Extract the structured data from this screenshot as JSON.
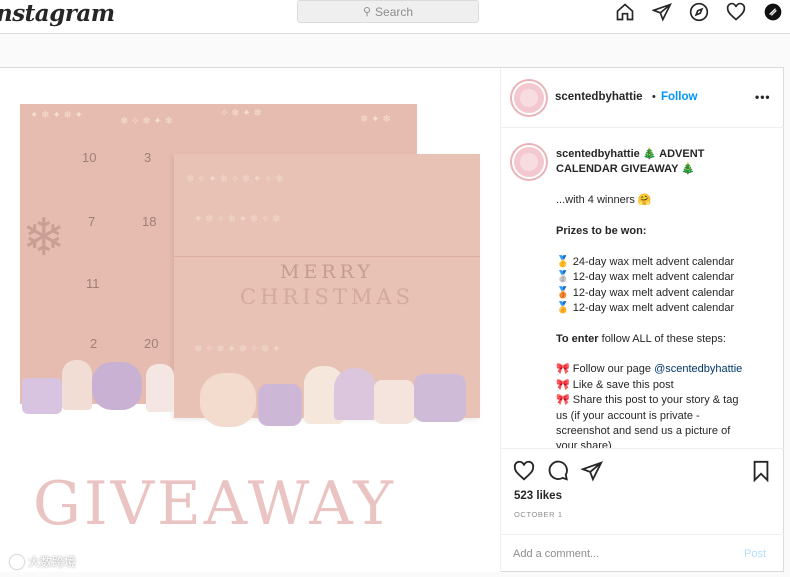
{
  "topbar": {
    "logo": "nstagram",
    "search_placeholder": "Search",
    "search_icon": "search-icon",
    "nav_icons": [
      "home-icon",
      "direct-icon",
      "explore-icon",
      "heart-icon",
      "profile-avatar"
    ]
  },
  "post": {
    "username": "scentedbyhattie",
    "separator": "•",
    "follow_label": "Follow",
    "more_label": "•••",
    "image_text": {
      "giveaway": "GIVEAWAY",
      "merry": "MERRY",
      "christmas": "CHRISTMAS",
      "back_box_numbers": [
        "10",
        "3",
        "7",
        "18",
        "11",
        "2",
        "20"
      ]
    },
    "caption": {
      "username": "scentedbyhattie",
      "title_rest": "🎄 ADVENT",
      "title_line2": "CALENDAR GIVEAWAY 🎄",
      "winners": "...with 4 winners 🤗",
      "prizes_heading": "Prizes to be won:",
      "prizes": [
        "🥇 24-day wax melt advent calendar",
        "🥈 12-day wax melt advent calendar",
        "🥉 12-day wax melt advent calendar",
        "🏅 12-day wax melt advent calendar"
      ],
      "to_enter_bold": "To enter",
      "to_enter_rest": " follow ALL of these steps:",
      "step1_prefix": "🎀 Follow our page ",
      "step1_link": "@scentedbyhattie",
      "step2": "🎀 Like & save this post",
      "step3_line1": "🎀 Share this post to your story & tag",
      "step3_line2": "us (if your account is private -",
      "step3_line3": "screenshot and send us a picture of",
      "step3_line4": "your share)"
    },
    "likes": "523 likes",
    "date": "OCTOBER 1",
    "comment_placeholder": "Add a comment...",
    "post_label": "Post"
  },
  "watermark": {
    "text": "大数跨境"
  },
  "colors": {
    "accent": "#0095f6",
    "box_pink": "#e7bcb0",
    "giveaway_pink": "#eac4c3"
  }
}
